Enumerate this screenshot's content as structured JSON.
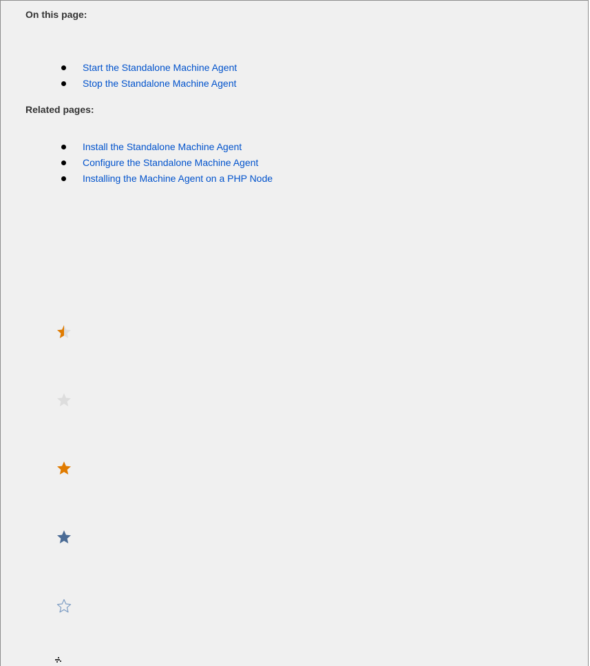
{
  "on_this_page": {
    "heading": "On this page:",
    "links": [
      "Start the Standalone Machine Agent",
      "Stop the Standalone Machine Agent"
    ]
  },
  "related_pages": {
    "heading": "Related pages:",
    "links": [
      "Install the Standalone Machine Agent",
      "Configure the Standalone Machine Agent",
      "Installing the Machine Agent on a PHP Node"
    ]
  },
  "icons": [
    "star-half-orange-icon",
    "star-grey-icon",
    "star-orange-icon",
    "star-blue-icon",
    "star-outline-icon",
    "small-sparkle-icon"
  ],
  "colors": {
    "link": "#0052cc",
    "star_orange": "#e07b00",
    "star_grey": "#dddddd",
    "star_blue": "#4a6b95",
    "star_outline": "#7f9ec4"
  }
}
